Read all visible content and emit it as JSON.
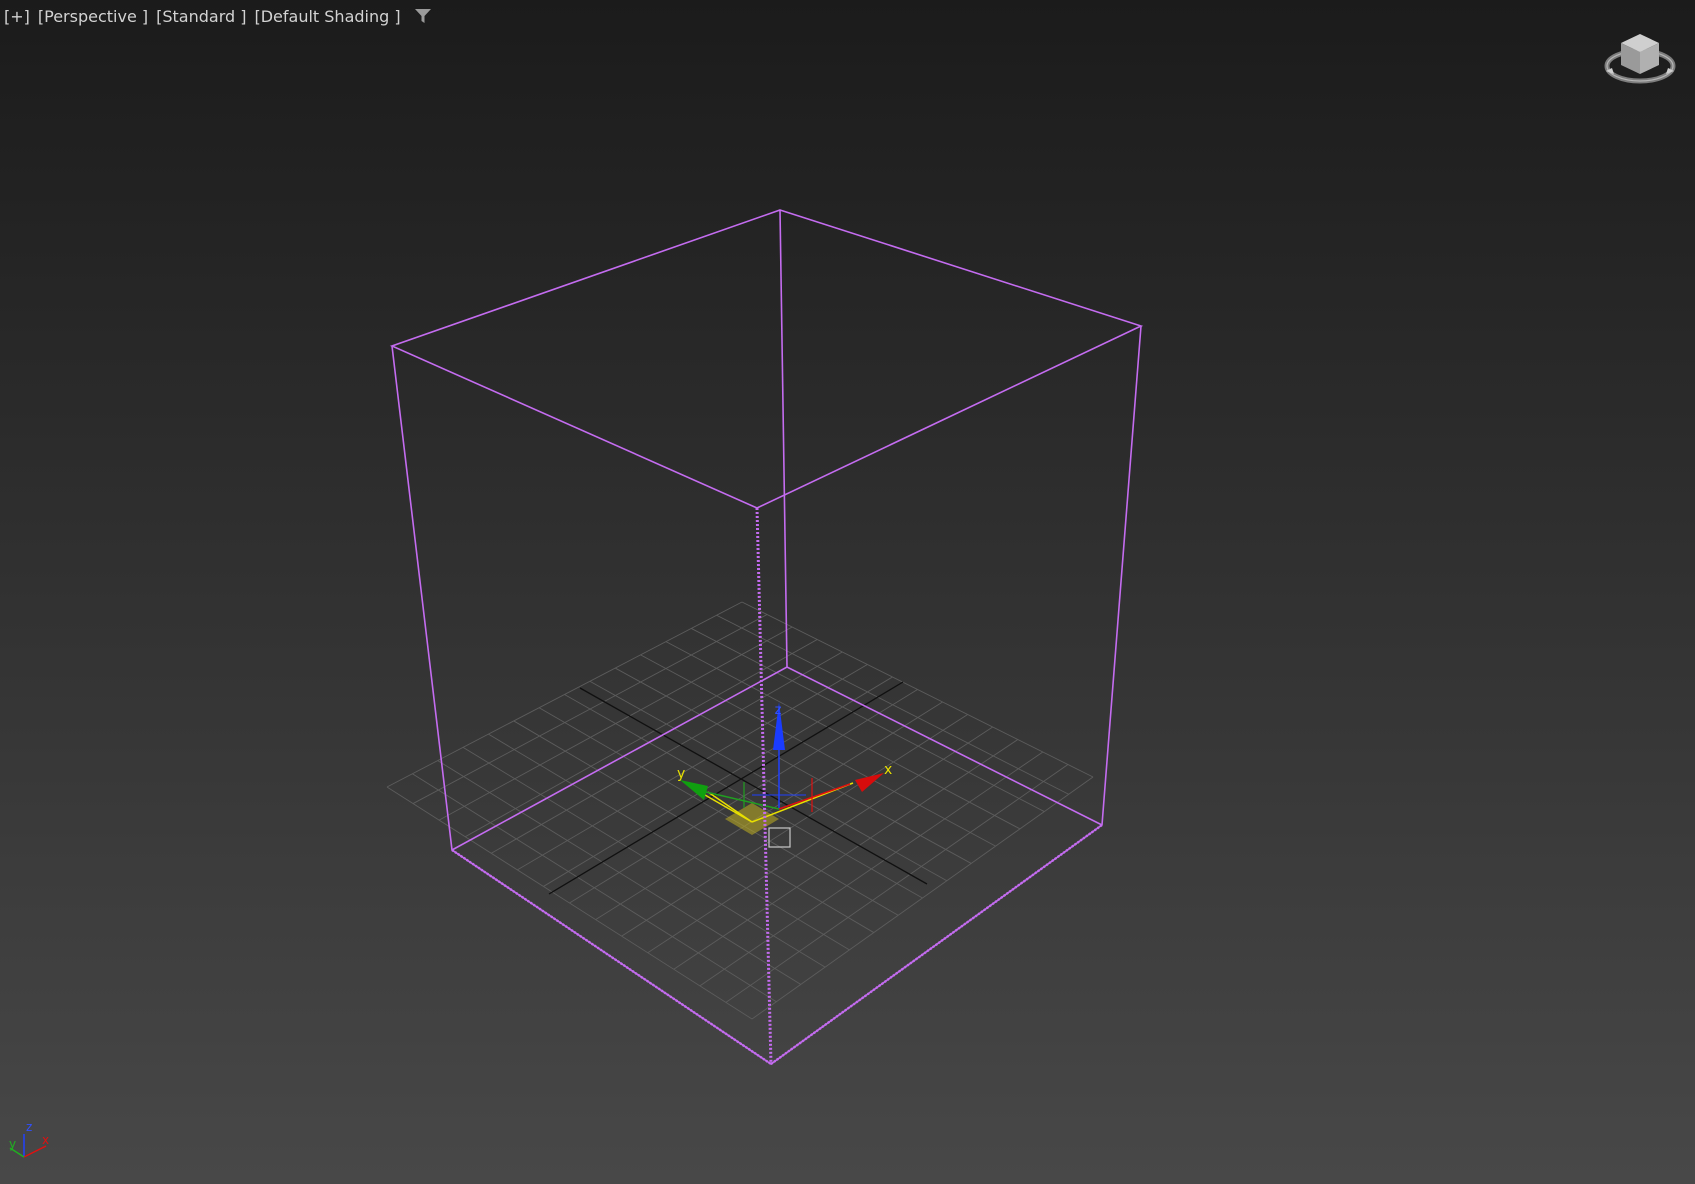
{
  "viewport": {
    "menu_label": "[+]",
    "view_label": "[Perspective ]",
    "mode_label": "[Standard ]",
    "shading_label": "[Default Shading ]",
    "filter_icon": "filter-funnel-icon"
  },
  "gizmo": {
    "x_label": "x",
    "y_label": "y",
    "z_label": "z"
  },
  "tripod": {
    "x_label": "x",
    "y_label": "y",
    "z_label": "z"
  },
  "colors": {
    "selection": "#c46cf0",
    "axis_x": "#e01010",
    "axis_y": "#20b020",
    "axis_z": "#2040ff",
    "gizmo_plane": "#e8e000",
    "grid": "#5c5c5c",
    "grid_main": "#101010"
  },
  "viewcube_icon": "viewcube-icon"
}
